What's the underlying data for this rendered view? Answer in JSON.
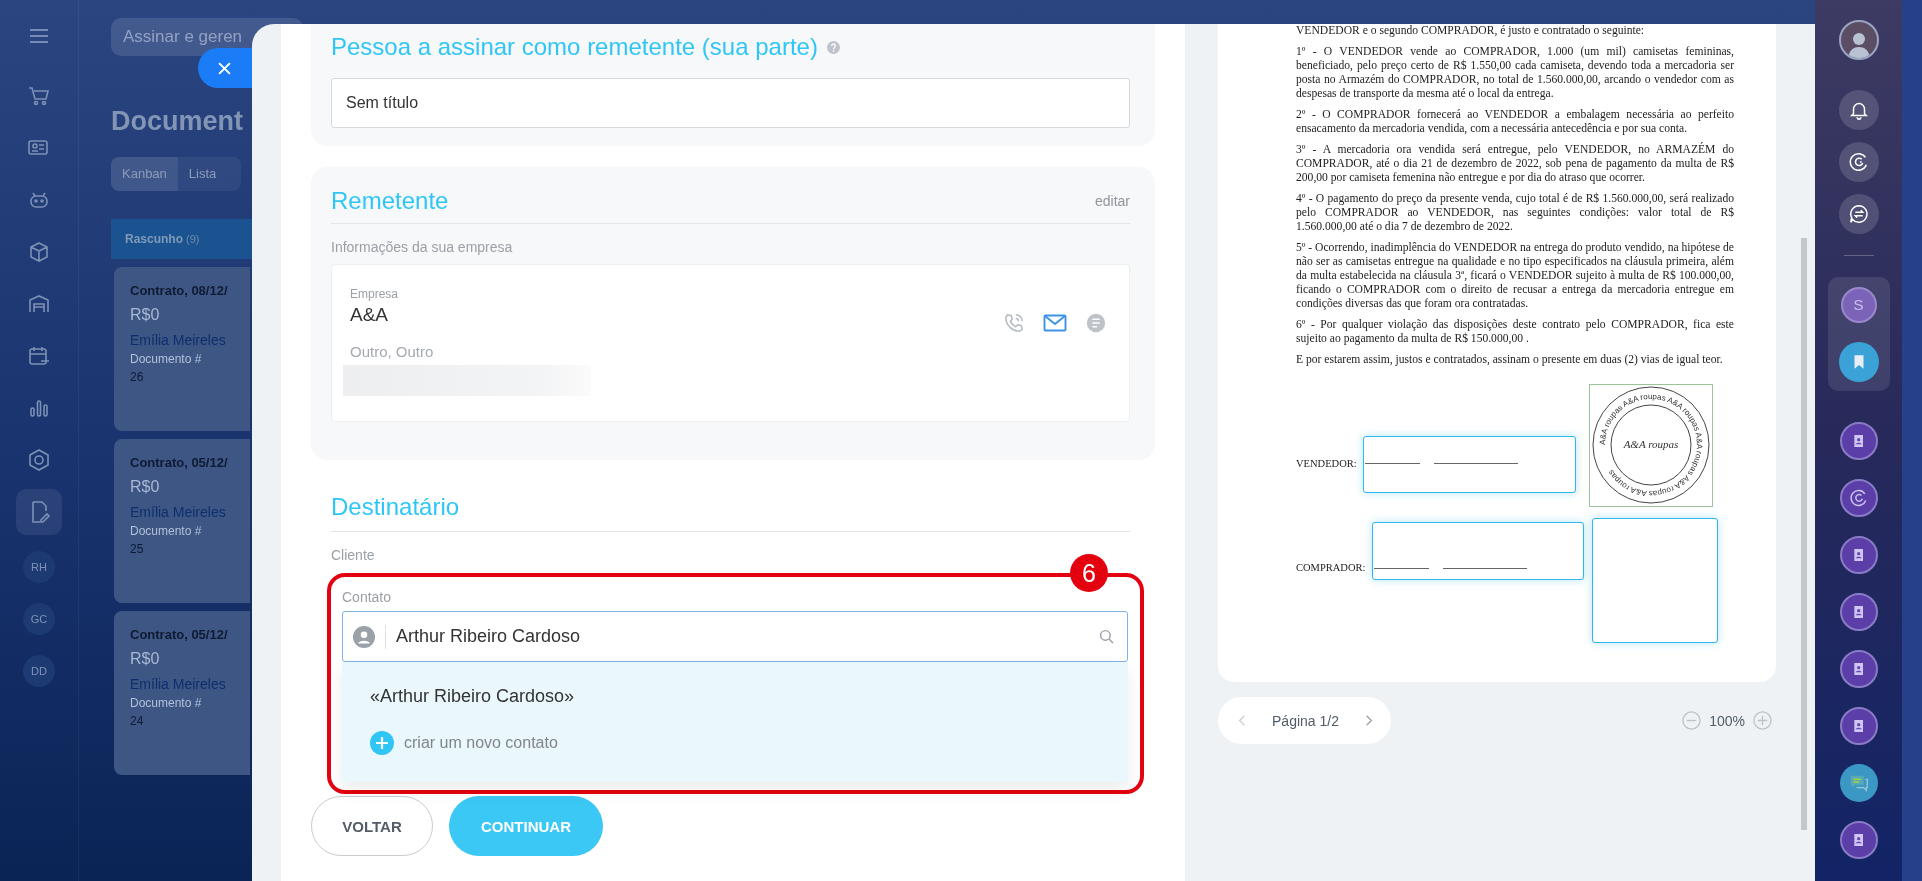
{
  "app": {
    "search_placeholder": "Assinar e geren",
    "page_title": "Document",
    "view_tabs": [
      {
        "label": "Kanban",
        "selected": true
      },
      {
        "label": "Lista",
        "selected": false
      }
    ],
    "nav_items": [
      {
        "kind": "icon",
        "selected": false
      },
      {
        "kind": "icon",
        "selected": false
      },
      {
        "kind": "icon",
        "selected": false
      },
      {
        "kind": "icon",
        "selected": false
      },
      {
        "kind": "icon",
        "selected": false
      },
      {
        "kind": "icon",
        "selected": false
      },
      {
        "kind": "icon",
        "selected": false
      },
      {
        "kind": "icon",
        "selected": false
      },
      {
        "kind": "icon",
        "selected": true
      },
      {
        "kind": "badge",
        "label": "RH",
        "selected": false
      },
      {
        "kind": "badge",
        "label": "GC",
        "selected": false
      },
      {
        "kind": "badge",
        "label": "DD",
        "selected": false
      }
    ],
    "column": {
      "title": "Rascunho",
      "count": "(9)"
    },
    "cards": [
      {
        "title": "Contrato, 08/12/",
        "amount": "R$0",
        "person": "Emília Meireles",
        "doc_label": "Documento #",
        "doc_number": "26"
      },
      {
        "title": "Contrato, 05/12/",
        "amount": "R$0",
        "person": "Emília Meireles",
        "doc_label": "Documento #",
        "doc_number": "25"
      },
      {
        "title": "Contrato, 05/12/",
        "amount": "R$0",
        "person": "Emília Meireles",
        "doc_label": "Documento #",
        "doc_number": "24"
      }
    ]
  },
  "form": {
    "signer": {
      "title": "Pessoa a assinar como remetente (sua parte)",
      "value": "Sem título"
    },
    "sender": {
      "title": "Remetente",
      "edit_link": "editar",
      "subtitle": "Informações da sua empresa",
      "company_label": "Empresa",
      "company_name": "A&A",
      "company_meta": "Outro, Outro"
    },
    "recipient": {
      "title": "Destinatário",
      "client_label": "Cliente",
      "contact_label": "Contato",
      "contact_value": "Arthur Ribeiro Cardoso",
      "suggestions": [
        {
          "kind": "match",
          "label": "«Arthur Ribeiro Cardoso»"
        },
        {
          "kind": "create",
          "label": "criar um novo contato"
        }
      ]
    },
    "annotation": {
      "label": "6"
    },
    "buttons": [
      {
        "kind": "secondary",
        "label": "VOLTAR"
      },
      {
        "kind": "primary",
        "label": "CONTINUAR"
      }
    ]
  },
  "document": {
    "paragraphs": [
      "VENDEDOR e o segundo COMPRADOR, é justo e contratado o seguinte:",
      "1º - O VENDEDOR vende ao COMPRADOR, 1.000 (um mil) camisetas femininas, beneficiado, pelo preço certo de R$ 1.550,00 cada camiseta, devendo toda a mercadoria ser posta no Armazém do COMPRADOR, no total de 1.560.000,00, arcando o vendedor com as despesas de transporte da mesma até o local da entrega.",
      "2º - O COMPRADOR fornecerá ao VENDEDOR a embalagem necessária ao perfeito ensacamento da mercadoria vendida, com a necessária antecedência e por sua conta.",
      "3º - A mercadoria ora vendida será entregue, pelo VENDEDOR, no ARMAZÉM do COMPRADOR, até o dia 21 de dezembro de 2022, sob pena de pagamento da multa de R$ 200,00 por camiseta femenina não entregue e por dia do atraso que ocorrer.",
      "4º - O pagamento do preço da presente venda, cujo total é de R$ 1.560.000,00, será realizado pelo COMPRADOR ao VENDEDOR, nas seguintes condições: valor total de R$ 1.560.000,00 até o dia 7 de dezembro de 2022.",
      "5º - Ocorrendo, inadimplência do VENDEDOR na entrega do produto vendido, na hipótese de não ser as camisetas entregue na qualidade e no tipo especificados na cláusula primeira, além da multa estabelecida na cláusula 3ª, ficará o VENDEDOR sujeito à multa de R$ 100.000,00, ficando o COMPRADOR com o direito de recusar a entrega da mercadoria entregue em condições diversas das que foram ora contratadas.",
      "6º - Por qualquer violação das disposições deste contrato pelo COMPRADOR, fica este sujeito ao pagamento da multa de R$ 150.000,00 .",
      "E por estarem assim, justos e contratados, assinam o presente em duas (2) vias de igual teor."
    ],
    "signatures": [
      {
        "label": "VENDEDOR:"
      },
      {
        "label": "COMPRADOR:"
      }
    ],
    "stamp": {
      "center_text": "A&A roupas",
      "ring_text": "A&A roupas A&A roupas A&A roupas A&A roupas A&A roupas A&A roupas"
    },
    "pager": {
      "label": "Página 1/2"
    },
    "zoom": "100%"
  },
  "right_bar": {
    "letter": "S"
  }
}
